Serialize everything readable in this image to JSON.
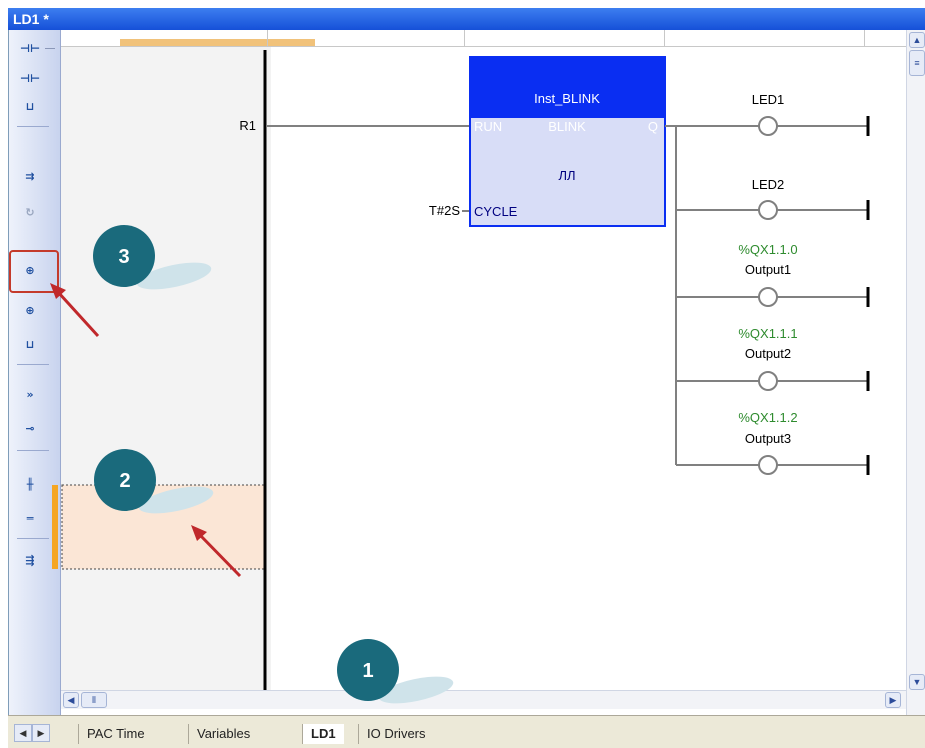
{
  "window": {
    "title": "LD1 *"
  },
  "ladder": {
    "left_contact": "R1",
    "fb": {
      "instance": "Inst_BLINK",
      "type": "BLINK",
      "in1": "RUN",
      "in2": "CYCLE",
      "out": "Q",
      "symbol": "ЛЛ"
    },
    "cycle_value": "T#2S",
    "coils": [
      {
        "address": "",
        "name": "LED1"
      },
      {
        "address": "",
        "name": "LED2"
      },
      {
        "address": "%QX1.1.0",
        "name": "Output1"
      },
      {
        "address": "%QX1.1.1",
        "name": "Output2"
      },
      {
        "address": "%QX1.1.2",
        "name": "Output3"
      }
    ]
  },
  "toolbar": {
    "icons": [
      "parallel-contact-before-icon",
      "parallel-contact-after-icon",
      "contact-below-icon",
      "contact-on-rung-icon",
      "refresh-icon",
      "coil-before-icon",
      "coil-after-icon",
      "coil-below-icon",
      "jump-icon",
      "return-icon",
      "horizontal-rung-icon",
      "double-line-icon",
      "comment-rung-icon"
    ]
  },
  "callouts": {
    "c1": "1",
    "c2": "2",
    "c3": "3"
  },
  "tabs": [
    "PAC Time",
    "Variables",
    "LD1",
    "IO Drivers"
  ],
  "colors": {
    "fb_fill": "#d8ddf7",
    "fb_header": "#0a2ef2",
    "callout": "#1a6a7c",
    "arrow": "#c0282b",
    "address": "#2e8b2e"
  }
}
